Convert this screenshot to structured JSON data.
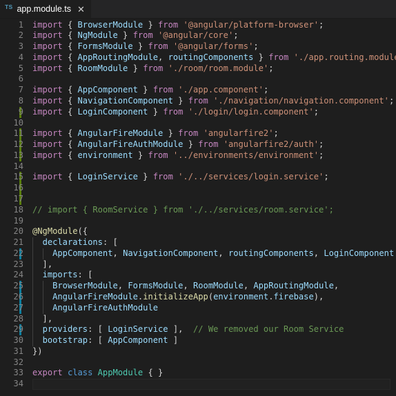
{
  "window": {
    "background": "#1e1e1e",
    "tabbar_background": "#252526"
  },
  "tabbar": {
    "tabs": [
      {
        "icon": "TS",
        "label": "app.module.ts",
        "close_label": "✕",
        "active": true
      }
    ]
  },
  "editor": {
    "language": "TypeScript",
    "file_name": "app.module.ts",
    "current_line": 34,
    "total_lines": 34,
    "colors": {
      "keyword": "#c586c0",
      "control": "#569cd6",
      "variable": "#9cdcfe",
      "type": "#4ec9b0",
      "string": "#ce9178",
      "comment": "#6a9955",
      "function": "#dcdcaa",
      "punctuation": "#d4d4d4",
      "gutter_added": "#587c0c",
      "gutter_modified": "#0c7d9d",
      "line_number": "#858585"
    },
    "lines": [
      {
        "n": 1,
        "mark": "",
        "indent": 0,
        "tokens": [
          [
            "t-kw",
            "import"
          ],
          [
            "t-pun",
            " { "
          ],
          [
            "t-var",
            "BrowserModule"
          ],
          [
            "t-pun",
            " } "
          ],
          [
            "t-kw",
            "from"
          ],
          [
            "t-pun",
            " "
          ],
          [
            "t-str",
            "'@angular/platform-browser'"
          ],
          [
            "t-pun",
            ";"
          ]
        ]
      },
      {
        "n": 2,
        "mark": "",
        "indent": 0,
        "tokens": [
          [
            "t-kw",
            "import"
          ],
          [
            "t-pun",
            " { "
          ],
          [
            "t-var",
            "NgModule"
          ],
          [
            "t-pun",
            " } "
          ],
          [
            "t-kw",
            "from"
          ],
          [
            "t-pun",
            " "
          ],
          [
            "t-str",
            "'@angular/core'"
          ],
          [
            "t-pun",
            ";"
          ]
        ]
      },
      {
        "n": 3,
        "mark": "",
        "indent": 0,
        "tokens": [
          [
            "t-kw",
            "import"
          ],
          [
            "t-pun",
            " { "
          ],
          [
            "t-var",
            "FormsModule"
          ],
          [
            "t-pun",
            " } "
          ],
          [
            "t-kw",
            "from"
          ],
          [
            "t-pun",
            " "
          ],
          [
            "t-str",
            "'@angular/forms'"
          ],
          [
            "t-pun",
            ";"
          ]
        ]
      },
      {
        "n": 4,
        "mark": "",
        "indent": 0,
        "tokens": [
          [
            "t-kw",
            "import"
          ],
          [
            "t-pun",
            " { "
          ],
          [
            "t-var",
            "AppRoutingModule"
          ],
          [
            "t-pun",
            ", "
          ],
          [
            "t-var",
            "routingComponents"
          ],
          [
            "t-pun",
            " } "
          ],
          [
            "t-kw",
            "from"
          ],
          [
            "t-pun",
            " "
          ],
          [
            "t-str",
            "'./app.routing.module'"
          ],
          [
            "t-pun",
            ";"
          ]
        ]
      },
      {
        "n": 5,
        "mark": "",
        "indent": 0,
        "tokens": [
          [
            "t-kw",
            "import"
          ],
          [
            "t-pun",
            " { "
          ],
          [
            "t-var",
            "RoomModule"
          ],
          [
            "t-pun",
            " } "
          ],
          [
            "t-kw",
            "from"
          ],
          [
            "t-pun",
            " "
          ],
          [
            "t-str",
            "'./room/room.module'"
          ],
          [
            "t-pun",
            ";"
          ]
        ]
      },
      {
        "n": 6,
        "mark": "",
        "indent": 0,
        "tokens": []
      },
      {
        "n": 7,
        "mark": "",
        "indent": 0,
        "tokens": [
          [
            "t-kw",
            "import"
          ],
          [
            "t-pun",
            " { "
          ],
          [
            "t-var",
            "AppComponent"
          ],
          [
            "t-pun",
            " } "
          ],
          [
            "t-kw",
            "from"
          ],
          [
            "t-pun",
            " "
          ],
          [
            "t-str",
            "'./app.component'"
          ],
          [
            "t-pun",
            ";"
          ]
        ]
      },
      {
        "n": 8,
        "mark": "",
        "indent": 0,
        "tokens": [
          [
            "t-kw",
            "import"
          ],
          [
            "t-pun",
            " { "
          ],
          [
            "t-var",
            "NavigationComponent"
          ],
          [
            "t-pun",
            " } "
          ],
          [
            "t-kw",
            "from"
          ],
          [
            "t-pun",
            " "
          ],
          [
            "t-str",
            "'./navigation/navigation.component'"
          ],
          [
            "t-pun",
            ";"
          ]
        ]
      },
      {
        "n": 9,
        "mark": "added",
        "indent": 0,
        "tokens": [
          [
            "t-kw",
            "import"
          ],
          [
            "t-pun",
            " { "
          ],
          [
            "t-var",
            "LoginComponent"
          ],
          [
            "t-pun",
            " } "
          ],
          [
            "t-kw",
            "from"
          ],
          [
            "t-pun",
            " "
          ],
          [
            "t-str",
            "'./login/login.component'"
          ],
          [
            "t-pun",
            ";"
          ]
        ]
      },
      {
        "n": 10,
        "mark": "",
        "indent": 0,
        "tokens": []
      },
      {
        "n": 11,
        "mark": "added",
        "indent": 0,
        "tokens": [
          [
            "t-kw",
            "import"
          ],
          [
            "t-pun",
            " { "
          ],
          [
            "t-var",
            "AngularFireModule"
          ],
          [
            "t-pun",
            " } "
          ],
          [
            "t-kw",
            "from"
          ],
          [
            "t-pun",
            " "
          ],
          [
            "t-str",
            "'angularfire2'"
          ],
          [
            "t-pun",
            ";"
          ]
        ]
      },
      {
        "n": 12,
        "mark": "added",
        "indent": 0,
        "tokens": [
          [
            "t-kw",
            "import"
          ],
          [
            "t-pun",
            " { "
          ],
          [
            "t-var",
            "AngularFireAuthModule"
          ],
          [
            "t-pun",
            " } "
          ],
          [
            "t-kw",
            "from"
          ],
          [
            "t-pun",
            " "
          ],
          [
            "t-str",
            "'angularfire2/auth'"
          ],
          [
            "t-pun",
            ";"
          ]
        ]
      },
      {
        "n": 13,
        "mark": "added",
        "indent": 0,
        "tokens": [
          [
            "t-kw",
            "import"
          ],
          [
            "t-pun",
            " { "
          ],
          [
            "t-var",
            "environment"
          ],
          [
            "t-pun",
            " } "
          ],
          [
            "t-kw",
            "from"
          ],
          [
            "t-pun",
            " "
          ],
          [
            "t-str",
            "'../environments/environment'"
          ],
          [
            "t-pun",
            ";"
          ]
        ]
      },
      {
        "n": 14,
        "mark": "",
        "indent": 0,
        "tokens": []
      },
      {
        "n": 15,
        "mark": "added",
        "indent": 0,
        "tokens": [
          [
            "t-kw",
            "import"
          ],
          [
            "t-pun",
            " { "
          ],
          [
            "t-var",
            "LoginService"
          ],
          [
            "t-pun",
            " } "
          ],
          [
            "t-kw",
            "from"
          ],
          [
            "t-pun",
            " "
          ],
          [
            "t-str",
            "'./../services/login.service'"
          ],
          [
            "t-pun",
            ";"
          ]
        ]
      },
      {
        "n": 16,
        "mark": "added",
        "indent": 0,
        "tokens": []
      },
      {
        "n": 17,
        "mark": "added",
        "indent": 0,
        "tokens": []
      },
      {
        "n": 18,
        "mark": "",
        "indent": 0,
        "tokens": [
          [
            "t-com",
            "// import { RoomService } from './../services/room.service';"
          ]
        ]
      },
      {
        "n": 19,
        "mark": "",
        "indent": 0,
        "tokens": []
      },
      {
        "n": 20,
        "mark": "",
        "indent": 0,
        "tokens": [
          [
            "t-fn",
            "@NgModule"
          ],
          [
            "t-pun",
            "({"
          ]
        ]
      },
      {
        "n": 21,
        "mark": "",
        "indent": 1,
        "tokens": [
          [
            "t-pun",
            "  "
          ],
          [
            "t-var",
            "declarations"
          ],
          [
            "t-pun",
            ": ["
          ]
        ]
      },
      {
        "n": 22,
        "mark": "modified",
        "indent": 2,
        "tokens": [
          [
            "t-pun",
            "    "
          ],
          [
            "t-var",
            "AppComponent"
          ],
          [
            "t-pun",
            ", "
          ],
          [
            "t-var",
            "NavigationComponent"
          ],
          [
            "t-pun",
            ", "
          ],
          [
            "t-var",
            "routingComponents"
          ],
          [
            "t-pun",
            ", "
          ],
          [
            "t-var",
            "LoginComponent"
          ]
        ]
      },
      {
        "n": 23,
        "mark": "",
        "indent": 1,
        "tokens": [
          [
            "t-pun",
            "  ],"
          ]
        ]
      },
      {
        "n": 24,
        "mark": "",
        "indent": 1,
        "tokens": [
          [
            "t-pun",
            "  "
          ],
          [
            "t-var",
            "imports"
          ],
          [
            "t-pun",
            ": ["
          ]
        ]
      },
      {
        "n": 25,
        "mark": "modified",
        "indent": 2,
        "tokens": [
          [
            "t-pun",
            "    "
          ],
          [
            "t-var",
            "BrowserModule"
          ],
          [
            "t-pun",
            ", "
          ],
          [
            "t-var",
            "FormsModule"
          ],
          [
            "t-pun",
            ", "
          ],
          [
            "t-var",
            "RoomModule"
          ],
          [
            "t-pun",
            ", "
          ],
          [
            "t-var",
            "AppRoutingModule"
          ],
          [
            "t-pun",
            ","
          ]
        ]
      },
      {
        "n": 26,
        "mark": "modified",
        "indent": 2,
        "tokens": [
          [
            "t-pun",
            "    "
          ],
          [
            "t-var",
            "AngularFireModule"
          ],
          [
            "t-pun",
            "."
          ],
          [
            "t-fn",
            "initializeApp"
          ],
          [
            "t-pun",
            "("
          ],
          [
            "t-var",
            "environment"
          ],
          [
            "t-pun",
            "."
          ],
          [
            "t-var",
            "firebase"
          ],
          [
            "t-pun",
            "),"
          ]
        ]
      },
      {
        "n": 27,
        "mark": "modified",
        "indent": 2,
        "tokens": [
          [
            "t-pun",
            "    "
          ],
          [
            "t-var",
            "AngularFireAuthModule"
          ]
        ]
      },
      {
        "n": 28,
        "mark": "",
        "indent": 1,
        "tokens": [
          [
            "t-pun",
            "  ],"
          ]
        ]
      },
      {
        "n": 29,
        "mark": "modified",
        "indent": 1,
        "tokens": [
          [
            "t-pun",
            "  "
          ],
          [
            "t-var",
            "providers"
          ],
          [
            "t-pun",
            ": [ "
          ],
          [
            "t-var",
            "LoginService"
          ],
          [
            "t-pun",
            " ],  "
          ],
          [
            "t-com",
            "// We removed our Room Service"
          ]
        ]
      },
      {
        "n": 30,
        "mark": "",
        "indent": 1,
        "tokens": [
          [
            "t-pun",
            "  "
          ],
          [
            "t-var",
            "bootstrap"
          ],
          [
            "t-pun",
            ": [ "
          ],
          [
            "t-var",
            "AppComponent"
          ],
          [
            "t-pun",
            " ]"
          ]
        ]
      },
      {
        "n": 31,
        "mark": "",
        "indent": 0,
        "tokens": [
          [
            "t-pun",
            "})"
          ]
        ]
      },
      {
        "n": 32,
        "mark": "",
        "indent": 0,
        "tokens": []
      },
      {
        "n": 33,
        "mark": "",
        "indent": 0,
        "tokens": [
          [
            "t-kw",
            "export"
          ],
          [
            "t-pun",
            " "
          ],
          [
            "t-ctrl",
            "class"
          ],
          [
            "t-pun",
            " "
          ],
          [
            "t-type",
            "AppModule"
          ],
          [
            "t-pun",
            " { }"
          ]
        ]
      },
      {
        "n": 34,
        "mark": "",
        "indent": 0,
        "tokens": []
      }
    ]
  }
}
